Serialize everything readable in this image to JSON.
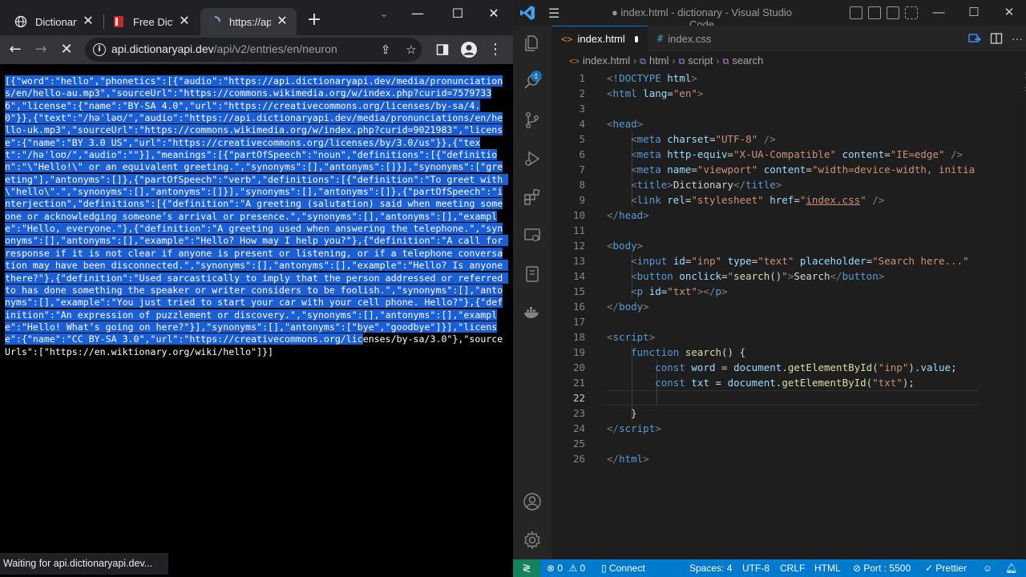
{
  "browser": {
    "tabs": [
      {
        "label": "Dictionary",
        "close": "✕"
      },
      {
        "label": "Free Dictio",
        "close": "✕"
      },
      {
        "label": "https://api",
        "close": "✕"
      }
    ],
    "new_tab": "+",
    "url_host": "api.dictionaryapi.dev",
    "url_path": "/api/v2/entries/en/neuron",
    "json_selected": "[{\"word\":\"hello\",\"phonetics\":[{\"audio\":\"https://api.dictionaryapi.dev/media/pronunciations/en/hello-au.mp3\",\"sourceUrl\":\"https://commons.wikimedia.org/w/index.php?curid=75797336\",\"license\":{\"name\":\"BY-SA 4.0\",\"url\":\"https://creativecommons.org/licenses/by-sa/4.0\"}},{\"text\":\"/həˈləʊ/\",\"audio\":\"https://api.dictionaryapi.dev/media/pronunciations/en/hello-uk.mp3\",\"sourceUrl\":\"https://commons.wikimedia.org/w/index.php?curid=9021983\",\"license\":{\"name\":\"BY 3.0 US\",\"url\":\"https://creativecommons.org/licenses/by/3.0/us\"}},{\"text\":\"/həˈloʊ/\",\"audio\":\"\"}],\"meanings\":[{\"partOfSpeech\":\"noun\",\"definitions\":[{\"definition\":\"\\\"Hello!\\\" or an equivalent greeting.\",\"synonyms\":[],\"antonyms\":[]}],\"synonyms\":[\"greeting\"],\"antonyms\":[]},{\"partOfSpeech\":\"verb\",\"definitions\":[{\"definition\":\"To greet with \\\"hello\\\".\",\"synonyms\":[],\"antonyms\":[]}],\"synonyms\":[],\"antonyms\":[]},{\"partOfSpeech\":\"interjection\",\"definitions\":[{\"definition\":\"A greeting (salutation) said when meeting someone or acknowledging someone’s arrival or presence.\",\"synonyms\":[],\"antonyms\":[],\"example\":\"Hello, everyone.\"},{\"definition\":\"A greeting used when answering the telephone.\",\"synonyms\":[],\"antonyms\":[],\"example\":\"Hello? How may I help you?\"},{\"definition\":\"A call for response if it is not clear if anyone is present or listening, or if a telephone conversation may have been disconnected.\",\"synonyms\":[],\"antonyms\":[],\"example\":\"Hello? Is anyone there?\"},{\"definition\":\"Used sarcastically to imply that the person addressed or referred to has done something the speaker or writer considers to be foolish.\",\"synonyms\":[],\"antonyms\":[],\"example\":\"You just tried to start your car with your cell phone. Hello?\"},{\"definition\":\"An expression of puzzlement or discovery.\",\"synonyms\":[],\"antonyms\":[],\"example\":\"Hello! What’s going on here?\"}],\"synonyms\":[],\"antonyms\":[\"bye\",\"goodbye\"]}],\"license\":{\"name\":\"CC BY-SA 3.0\",\"url\":\"https://creativecommons.org/lic",
    "json_unselected": "enses/by-sa/3.0\"},\"sourceUrls\":[\"https://en.wiktionary.org/wiki/hello\"]}]",
    "status_text": "Waiting for api.dictionaryapi.dev..."
  },
  "vscode": {
    "window_title": "● index.html - dictionary - Visual Studio Code",
    "tabs": [
      {
        "label": "index.html",
        "icon": "<>"
      },
      {
        "label": "index.css",
        "icon": "#"
      }
    ],
    "breadcrumbs": [
      "index.html",
      "html",
      "script",
      "search"
    ],
    "line_numbers": [
      "1",
      "2",
      "3",
      "4",
      "5",
      "6",
      "7",
      "8",
      "9",
      "10",
      "11",
      "12",
      "13",
      "14",
      "15",
      "16",
      "17",
      "18",
      "19",
      "20",
      "21",
      "22",
      "23",
      "24",
      "25",
      "26"
    ],
    "status": {
      "errors": "0",
      "warnings": "0",
      "connect": "Connect",
      "spaces": "Spaces: 4",
      "encoding": "UTF-8",
      "eol": "CRLF",
      "language": "HTML",
      "port": "Port : 5500",
      "prettier": "Prettier"
    },
    "colors": {
      "accent": "#007acc",
      "remote": "#16825d",
      "selection": "#1a5fd6"
    }
  }
}
